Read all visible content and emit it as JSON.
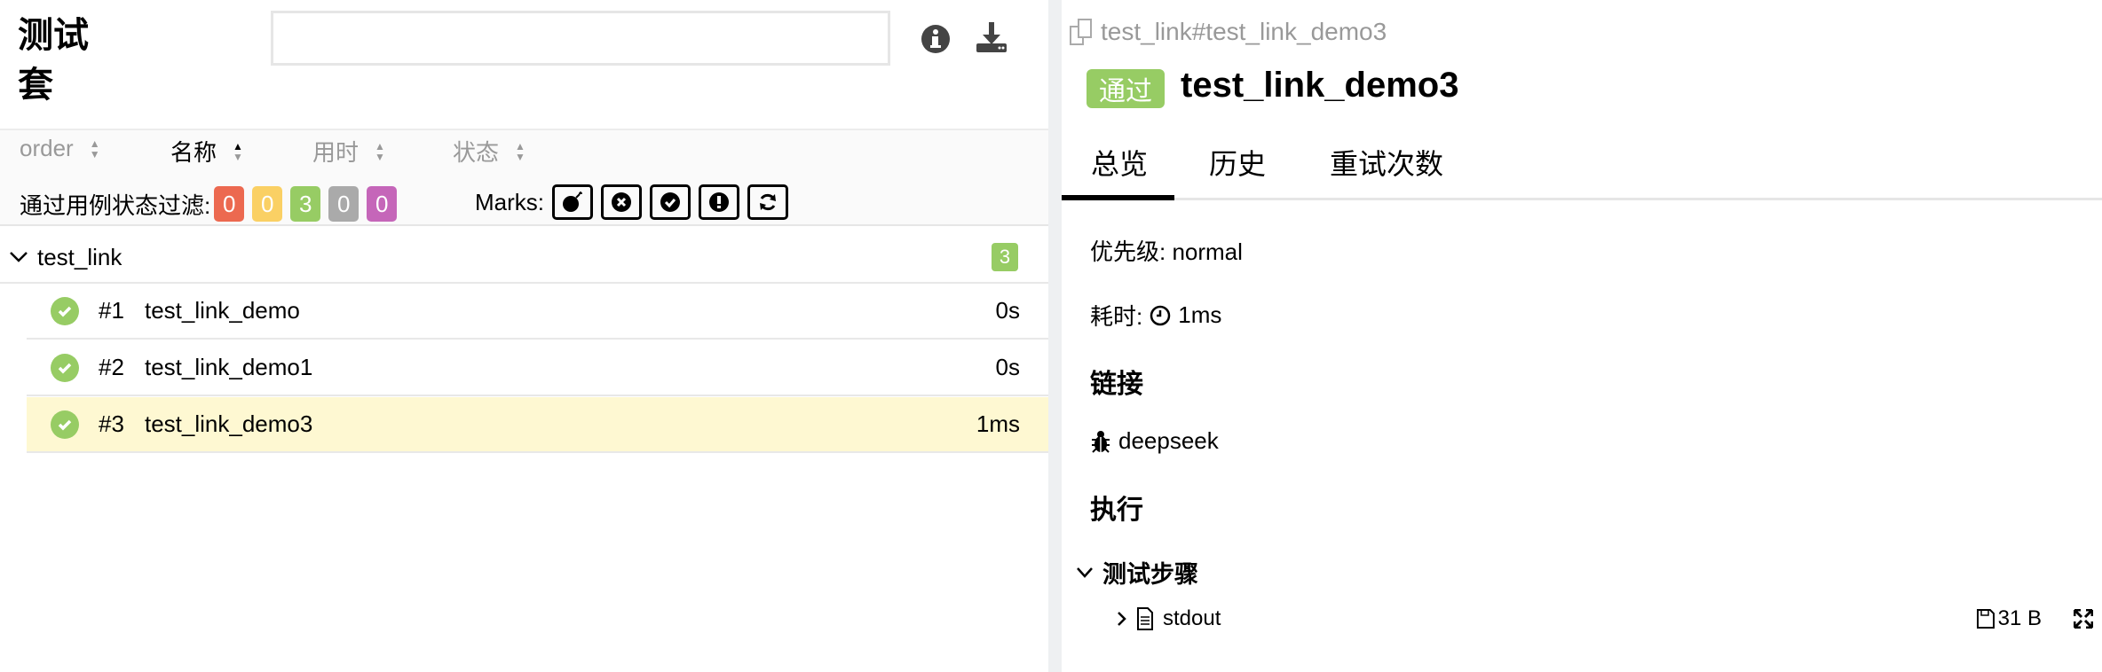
{
  "left": {
    "title": "测试套",
    "search": {
      "placeholder": "",
      "value": ""
    },
    "icons": [
      "info-icon",
      "download-icon"
    ],
    "sort": [
      {
        "label": "order",
        "active": false
      },
      {
        "label": "名称",
        "active": true,
        "direction": "asc"
      },
      {
        "label": "用时",
        "active": false
      },
      {
        "label": "状态",
        "active": false
      }
    ],
    "filter": {
      "label": "通过用例状态过滤:",
      "badges": [
        {
          "count": "0",
          "color": "#ec6950"
        },
        {
          "count": "0",
          "color": "#fad064"
        },
        {
          "count": "3",
          "color": "#97cc64"
        },
        {
          "count": "0",
          "color": "#aaaaaa"
        },
        {
          "count": "0",
          "color": "#c566b9"
        }
      ]
    },
    "marks": {
      "label": "Marks:",
      "icons": [
        "bomb-icon",
        "times-circle-icon",
        "check-circle-icon",
        "exclamation-circle-icon",
        "refresh-icon"
      ]
    },
    "group": {
      "name": "test_link",
      "count": "3"
    },
    "rows": [
      {
        "order": "#1",
        "name": "test_link_demo",
        "duration": "0s",
        "selected": false
      },
      {
        "order": "#2",
        "name": "test_link_demo1",
        "duration": "0s",
        "selected": false
      },
      {
        "order": "#3",
        "name": "test_link_demo3",
        "duration": "1ms",
        "selected": true
      }
    ]
  },
  "right": {
    "breadcrumb": "test_link#test_link_demo3",
    "status": "通过",
    "status_color": "#97cc64",
    "title": "test_link_demo3",
    "tabs": [
      "总览",
      "历史",
      "重试次数"
    ],
    "active_tab": "总览",
    "priority": "优先级: normal",
    "duration_label": "耗时:",
    "duration": "1ms",
    "links_heading": "链接",
    "link": "deepseek",
    "execution_heading": "执行",
    "steps_heading": "测试步骤",
    "attachment": {
      "name": "stdout",
      "size": "31 B"
    }
  }
}
